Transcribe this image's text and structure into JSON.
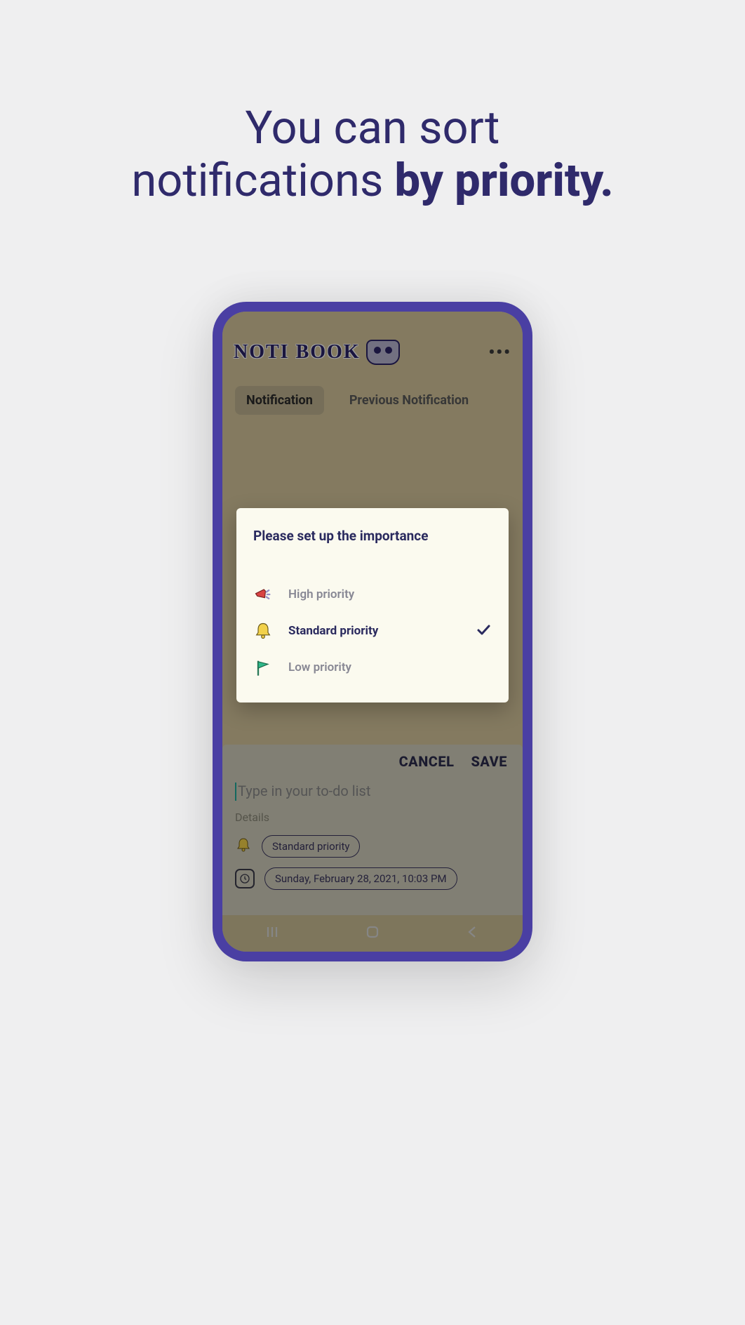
{
  "headline": {
    "line1": "You can sort",
    "line2_prefix": "notifications ",
    "line2_bold": "by priority."
  },
  "app": {
    "title": "NOTI BOOK"
  },
  "tabs": {
    "notification": "Notification",
    "previous": "Previous Notification"
  },
  "dialog": {
    "title": "Please set up the importance",
    "options": {
      "high": "High priority",
      "standard": "Standard priority",
      "low": "Low priority"
    },
    "selected": "standard"
  },
  "panel": {
    "cancel": "CANCEL",
    "save": "SAVE",
    "todo_placeholder": "Type in your to-do list",
    "details_label": "Details",
    "priority_chip": "Standard priority",
    "date_chip": "Sunday, February 28, 2021, 10:03 PM"
  },
  "colors": {
    "brand": "#2f2a6b",
    "phone_frame": "#4a3fa3",
    "screen_bg": "#d5c69c",
    "dialog_bg": "#fbfaef"
  }
}
